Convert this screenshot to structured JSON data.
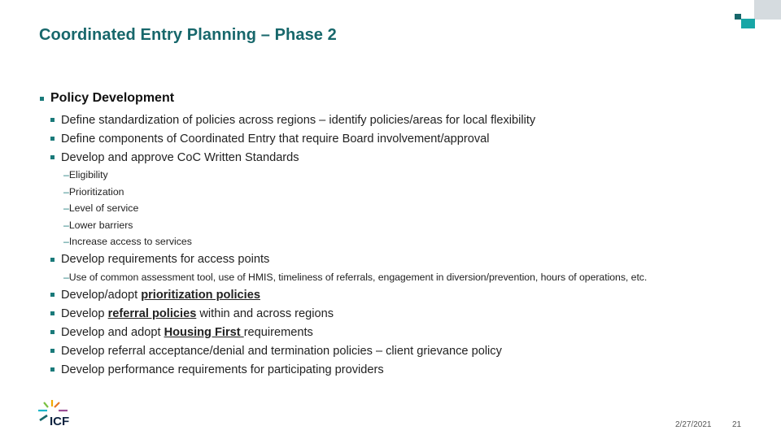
{
  "slide": {
    "title": "Coordinated Entry Planning – Phase 2",
    "heading": "Policy Development",
    "items_a": [
      "Define standardization of policies across regions – identify policies/areas for local flexibility",
      "Define components of Coordinated Entry that require Board involvement/approval",
      "Develop and approve CoC Written Standards"
    ],
    "written_standards_subitems": [
      "Eligibility",
      "Prioritization",
      "Level of service",
      "Lower barriers",
      "Increase access to services"
    ],
    "access_points_item": "Develop requirements for access points",
    "access_points_subitem": "Use of common assessment tool, use of HMIS, timeliness of referrals, engagement in diversion/prevention, hours of operations, etc.",
    "items_b": [
      {
        "pre": "Develop/adopt ",
        "emph": "prioritization policies",
        "post": ""
      },
      {
        "pre": "Develop ",
        "emph": "referral policies",
        "post": " within and across regions"
      },
      {
        "pre": "Develop and adopt ",
        "emph": "Housing First ",
        "post": "requirements"
      }
    ],
    "items_c": [
      "Develop referral acceptance/denial and termination policies – client grievance policy",
      "Develop performance requirements for participating providers"
    ],
    "dash": "–"
  },
  "footer": {
    "logo_text": "ICF",
    "date": "2/27/2021",
    "page_number": "21"
  },
  "colors": {
    "title": "#17676b",
    "accent_teal": "#18a6a6",
    "bullet": "#1a7a7a",
    "corner_gray": "#d5dbdf"
  }
}
